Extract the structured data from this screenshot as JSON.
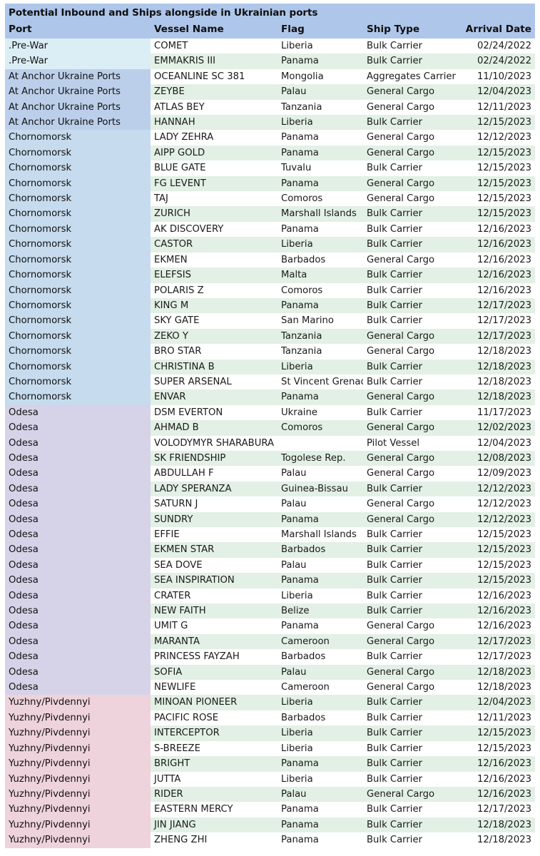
{
  "table": {
    "title": "Potential Inbound and Ships alongside in Ukrainian ports",
    "columns": [
      "Port",
      "Vessel Name",
      "Flag",
      "Ship Type",
      "Arrival Date"
    ],
    "colors": {
      "header_bg": "#aec6ea",
      "stripe_a": "#ffffff",
      "stripe_b": "#e3f0e5",
      "port_prewar": "#dbeef5",
      "port_at_anchor": "#bccfea",
      "port_chornomorsk": "#c6dbee",
      "port_odesa": "#d6d3e8",
      "port_yuzhny": "#eed2dc"
    },
    "rows": [
      {
        "port": ".Pre-War",
        "vessel": "COMET",
        "flag": "Liberia",
        "type": "Bulk Carrier",
        "date": "02/24/2022",
        "port_color": "#dbeef5"
      },
      {
        "port": ".Pre-War",
        "vessel": "EMMAKRIS III",
        "flag": "Panama",
        "type": "Bulk Carrier",
        "date": "02/24/2022",
        "port_color": "#dbeef5"
      },
      {
        "port": "At Anchor Ukraine Ports",
        "vessel": "OCEANLINE SC 381",
        "flag": "Mongolia",
        "type": "Aggregates Carrier",
        "date": "11/10/2023",
        "port_color": "#bccfea"
      },
      {
        "port": "At Anchor Ukraine Ports",
        "vessel": "ZEYBE",
        "flag": "Palau",
        "type": "General Cargo",
        "date": "12/04/2023",
        "port_color": "#bccfea"
      },
      {
        "port": "At Anchor Ukraine Ports",
        "vessel": "ATLAS BEY",
        "flag": "Tanzania",
        "type": "General Cargo",
        "date": "12/11/2023",
        "port_color": "#bccfea"
      },
      {
        "port": "At Anchor Ukraine Ports",
        "vessel": "HANNAH",
        "flag": "Liberia",
        "type": "Bulk Carrier",
        "date": "12/15/2023",
        "port_color": "#bccfea"
      },
      {
        "port": "Chornomorsk",
        "vessel": "LADY ZEHRA",
        "flag": "Panama",
        "type": "General Cargo",
        "date": "12/12/2023",
        "port_color": "#c6dbee"
      },
      {
        "port": "Chornomorsk",
        "vessel": "AIPP GOLD",
        "flag": "Panama",
        "type": "General Cargo",
        "date": "12/15/2023",
        "port_color": "#c6dbee"
      },
      {
        "port": "Chornomorsk",
        "vessel": "BLUE GATE",
        "flag": "Tuvalu",
        "type": "Bulk Carrier",
        "date": "12/15/2023",
        "port_color": "#c6dbee"
      },
      {
        "port": "Chornomorsk",
        "vessel": "FG LEVENT",
        "flag": "Panama",
        "type": "General Cargo",
        "date": "12/15/2023",
        "port_color": "#c6dbee"
      },
      {
        "port": "Chornomorsk",
        "vessel": "TAJ",
        "flag": "Comoros",
        "type": "General Cargo",
        "date": "12/15/2023",
        "port_color": "#c6dbee"
      },
      {
        "port": "Chornomorsk",
        "vessel": "ZURICH",
        "flag": "Marshall Islands",
        "type": "Bulk Carrier",
        "date": "12/15/2023",
        "port_color": "#c6dbee"
      },
      {
        "port": "Chornomorsk",
        "vessel": "AK DISCOVERY",
        "flag": "Panama",
        "type": "Bulk Carrier",
        "date": "12/16/2023",
        "port_color": "#c6dbee"
      },
      {
        "port": "Chornomorsk",
        "vessel": "CASTOR",
        "flag": "Liberia",
        "type": "Bulk Carrier",
        "date": "12/16/2023",
        "port_color": "#c6dbee"
      },
      {
        "port": "Chornomorsk",
        "vessel": "EKMEN",
        "flag": "Barbados",
        "type": "General Cargo",
        "date": "12/16/2023",
        "port_color": "#c6dbee"
      },
      {
        "port": "Chornomorsk",
        "vessel": "ELEFSIS",
        "flag": "Malta",
        "type": "Bulk Carrier",
        "date": "12/16/2023",
        "port_color": "#c6dbee"
      },
      {
        "port": "Chornomorsk",
        "vessel": "POLARIS Z",
        "flag": "Comoros",
        "type": "Bulk Carrier",
        "date": "12/16/2023",
        "port_color": "#c6dbee"
      },
      {
        "port": "Chornomorsk",
        "vessel": "KING M",
        "flag": "Panama",
        "type": "Bulk Carrier",
        "date": "12/17/2023",
        "port_color": "#c6dbee"
      },
      {
        "port": "Chornomorsk",
        "vessel": "SKY GATE",
        "flag": "San Marino",
        "type": "Bulk Carrier",
        "date": "12/17/2023",
        "port_color": "#c6dbee"
      },
      {
        "port": "Chornomorsk",
        "vessel": "ZEKO Y",
        "flag": "Tanzania",
        "type": "General Cargo",
        "date": "12/17/2023",
        "port_color": "#c6dbee"
      },
      {
        "port": "Chornomorsk",
        "vessel": "BRO STAR",
        "flag": "Tanzania",
        "type": "General Cargo",
        "date": "12/18/2023",
        "port_color": "#c6dbee"
      },
      {
        "port": "Chornomorsk",
        "vessel": "CHRISTINA B",
        "flag": "Liberia",
        "type": "Bulk Carrier",
        "date": "12/18/2023",
        "port_color": "#c6dbee"
      },
      {
        "port": "Chornomorsk",
        "vessel": "SUPER ARSENAL",
        "flag": "St Vincent Grenadines",
        "type": "Bulk Carrier",
        "date": "12/18/2023",
        "port_color": "#c6dbee"
      },
      {
        "port": "Chornomorsk",
        "vessel": "ENVAR",
        "flag": "Panama",
        "type": "General Cargo",
        "date": "12/18/2023",
        "port_color": "#c6dbee"
      },
      {
        "port": "Odesa",
        "vessel": "DSM EVERTON",
        "flag": "Ukraine",
        "type": "Bulk Carrier",
        "date": "11/17/2023",
        "port_color": "#d6d3e8"
      },
      {
        "port": "Odesa",
        "vessel": "AHMAD B",
        "flag": "Comoros",
        "type": "General Cargo",
        "date": "12/02/2023",
        "port_color": "#d6d3e8"
      },
      {
        "port": "Odesa",
        "vessel": "VOLODYMYR SHARABURA",
        "flag": "",
        "type": "Pilot Vessel",
        "date": "12/04/2023",
        "port_color": "#d6d3e8"
      },
      {
        "port": "Odesa",
        "vessel": "SK FRIENDSHIP",
        "flag": "Togolese Rep.",
        "type": "General Cargo",
        "date": "12/08/2023",
        "port_color": "#d6d3e8"
      },
      {
        "port": "Odesa",
        "vessel": "ABDULLAH F",
        "flag": "Palau",
        "type": "General Cargo",
        "date": "12/09/2023",
        "port_color": "#d6d3e8"
      },
      {
        "port": "Odesa",
        "vessel": "LADY SPERANZA",
        "flag": "Guinea-Bissau",
        "type": "Bulk Carrier",
        "date": "12/12/2023",
        "port_color": "#d6d3e8"
      },
      {
        "port": "Odesa",
        "vessel": "SATURN J",
        "flag": "Palau",
        "type": "General Cargo",
        "date": "12/12/2023",
        "port_color": "#d6d3e8"
      },
      {
        "port": "Odesa",
        "vessel": "SUNDRY",
        "flag": "Panama",
        "type": "General Cargo",
        "date": "12/12/2023",
        "port_color": "#d6d3e8"
      },
      {
        "port": "Odesa",
        "vessel": "EFFIE",
        "flag": "Marshall Islands",
        "type": "Bulk Carrier",
        "date": "12/15/2023",
        "port_color": "#d6d3e8"
      },
      {
        "port": "Odesa",
        "vessel": "EKMEN STAR",
        "flag": "Barbados",
        "type": "Bulk Carrier",
        "date": "12/15/2023",
        "port_color": "#d6d3e8"
      },
      {
        "port": "Odesa",
        "vessel": "SEA DOVE",
        "flag": "Palau",
        "type": "Bulk Carrier",
        "date": "12/15/2023",
        "port_color": "#d6d3e8"
      },
      {
        "port": "Odesa",
        "vessel": "SEA INSPIRATION",
        "flag": "Panama",
        "type": "Bulk Carrier",
        "date": "12/15/2023",
        "port_color": "#d6d3e8"
      },
      {
        "port": "Odesa",
        "vessel": "CRATER",
        "flag": "Liberia",
        "type": "Bulk Carrier",
        "date": "12/16/2023",
        "port_color": "#d6d3e8"
      },
      {
        "port": "Odesa",
        "vessel": "NEW FAITH",
        "flag": "Belize",
        "type": "Bulk Carrier",
        "date": "12/16/2023",
        "port_color": "#d6d3e8"
      },
      {
        "port": "Odesa",
        "vessel": "UMIT G",
        "flag": "Panama",
        "type": "General Cargo",
        "date": "12/16/2023",
        "port_color": "#d6d3e8"
      },
      {
        "port": "Odesa",
        "vessel": "MARANTA",
        "flag": "Cameroon",
        "type": "General Cargo",
        "date": "12/17/2023",
        "port_color": "#d6d3e8"
      },
      {
        "port": "Odesa",
        "vessel": "PRINCESS FAYZAH",
        "flag": "Barbados",
        "type": "Bulk Carrier",
        "date": "12/17/2023",
        "port_color": "#d6d3e8"
      },
      {
        "port": "Odesa",
        "vessel": "SOFIA",
        "flag": "Palau",
        "type": "General Cargo",
        "date": "12/18/2023",
        "port_color": "#d6d3e8"
      },
      {
        "port": "Odesa",
        "vessel": "NEWLIFE",
        "flag": "Cameroon",
        "type": "General Cargo",
        "date": "12/18/2023",
        "port_color": "#d6d3e8"
      },
      {
        "port": "Yuzhny/Pivdennyi",
        "vessel": "MINOAN PIONEER",
        "flag": "Liberia",
        "type": "Bulk Carrier",
        "date": "12/04/2023",
        "port_color": "#eed2dc"
      },
      {
        "port": "Yuzhny/Pivdennyi",
        "vessel": "PACIFIC ROSE",
        "flag": "Barbados",
        "type": "Bulk Carrier",
        "date": "12/11/2023",
        "port_color": "#eed2dc"
      },
      {
        "port": "Yuzhny/Pivdennyi",
        "vessel": "INTERCEPTOR",
        "flag": "Liberia",
        "type": "Bulk Carrier",
        "date": "12/15/2023",
        "port_color": "#eed2dc"
      },
      {
        "port": "Yuzhny/Pivdennyi",
        "vessel": "S-BREEZE",
        "flag": "Liberia",
        "type": "Bulk Carrier",
        "date": "12/15/2023",
        "port_color": "#eed2dc"
      },
      {
        "port": "Yuzhny/Pivdennyi",
        "vessel": "BRIGHT",
        "flag": "Panama",
        "type": "Bulk Carrier",
        "date": "12/16/2023",
        "port_color": "#eed2dc"
      },
      {
        "port": "Yuzhny/Pivdennyi",
        "vessel": "JUTTA",
        "flag": "Liberia",
        "type": "Bulk Carrier",
        "date": "12/16/2023",
        "port_color": "#eed2dc"
      },
      {
        "port": "Yuzhny/Pivdennyi",
        "vessel": "RIDER",
        "flag": "Palau",
        "type": "General Cargo",
        "date": "12/16/2023",
        "port_color": "#eed2dc"
      },
      {
        "port": "Yuzhny/Pivdennyi",
        "vessel": "EASTERN MERCY",
        "flag": "Panama",
        "type": "Bulk Carrier",
        "date": "12/17/2023",
        "port_color": "#eed2dc"
      },
      {
        "port": "Yuzhny/Pivdennyi",
        "vessel": "JIN JIANG",
        "flag": "Panama",
        "type": "Bulk Carrier",
        "date": "12/18/2023",
        "port_color": "#eed2dc"
      },
      {
        "port": "Yuzhny/Pivdennyi",
        "vessel": "ZHENG ZHI",
        "flag": "Panama",
        "type": "Bulk Carrier",
        "date": "12/18/2023",
        "port_color": "#eed2dc"
      }
    ]
  }
}
